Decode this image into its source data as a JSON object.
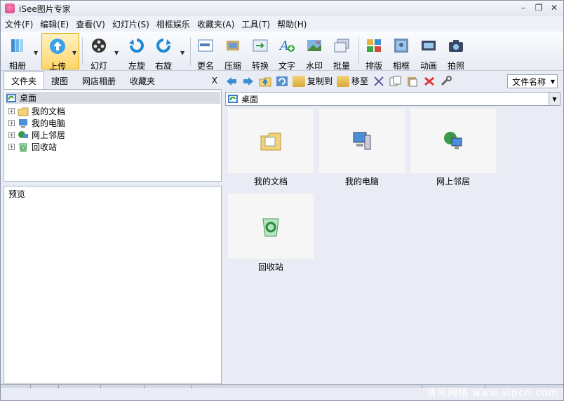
{
  "app": {
    "title": "iSee图片专家"
  },
  "menu": [
    "文件(F)",
    "编辑(E)",
    "查看(V)",
    "幻灯片(S)",
    "相框娱乐",
    "收藏夹(A)",
    "工具(T)",
    "帮助(H)"
  ],
  "toolbar": {
    "album": "相册",
    "upload": "上传",
    "slideshow": "幻灯",
    "rotate_left": "左旋",
    "rotate_right": "右旋",
    "rename": "更名",
    "compress": "压缩",
    "convert": "转换",
    "text": "文字",
    "watermark": "水印",
    "batch": "批量",
    "layout": "排版",
    "frame": "相框",
    "animation": "动画",
    "camera": "拍照"
  },
  "left_tabs": [
    "文件夹",
    "搜图",
    "网店相册",
    "收藏夹"
  ],
  "left_close": "X",
  "tree": {
    "root": "桌面",
    "items": [
      "我的文档",
      "我的电脑",
      "网上邻居",
      "回收站"
    ]
  },
  "preview_label": "预览",
  "right_toolbar": {
    "copy_to": "复制到",
    "move_to": "移至",
    "sort": "文件名称"
  },
  "address": "桌面",
  "thumbnails": [
    "我的文档",
    "我的电脑",
    "网上邻居",
    "回收站"
  ],
  "watermark": "清风网络 www.vipcn.com"
}
